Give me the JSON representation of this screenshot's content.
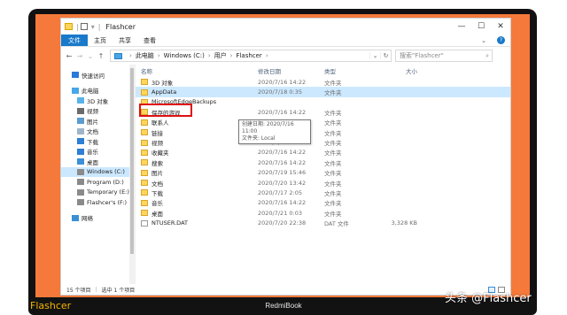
{
  "window": {
    "title": "Flashcer",
    "controls": {
      "minimize": "—",
      "maximize": "☐",
      "close": "✕"
    }
  },
  "ribbon": {
    "tabs": [
      "文件",
      "主页",
      "共享",
      "查看"
    ],
    "help_icon": "?"
  },
  "address": {
    "back_icon": "←",
    "forward_icon": "→",
    "up_icon": "↑",
    "crumbs": [
      "此电脑",
      "Windows (C:)",
      "用户",
      "Flashcer"
    ],
    "dropdown_icon": "⌄",
    "refresh_icon": "↻",
    "search_placeholder": "搜索\"Flashcer\"",
    "search_icon": "⌕"
  },
  "nav": {
    "items": [
      {
        "label": "快速访问",
        "level": 1,
        "icon": "star-icon",
        "color": "#2b79d8"
      },
      {
        "label": "此电脑",
        "level": 1,
        "icon": "pc-icon",
        "color": "#47a6e8",
        "gap": true
      },
      {
        "label": "3D 对象",
        "level": 2,
        "icon": "3d-objects-icon",
        "color": "#58b3e8"
      },
      {
        "label": "视频",
        "level": 2,
        "icon": "videos-icon",
        "color": "#6b6b6b"
      },
      {
        "label": "图片",
        "level": 2,
        "icon": "pictures-icon",
        "color": "#5c9ccf"
      },
      {
        "label": "文档",
        "level": 2,
        "icon": "documents-icon",
        "color": "#9fb5c9"
      },
      {
        "label": "下载",
        "level": 2,
        "icon": "downloads-icon",
        "color": "#2d7ed4"
      },
      {
        "label": "音乐",
        "level": 2,
        "icon": "music-icon",
        "color": "#2d7ed4"
      },
      {
        "label": "桌面",
        "level": 2,
        "icon": "desktop-icon",
        "color": "#3b8fd6"
      },
      {
        "label": "Windows (C:)",
        "level": 2,
        "icon": "drive-icon",
        "color": "#8a8a8a",
        "selected": true
      },
      {
        "label": "Program (D:)",
        "level": 2,
        "icon": "drive-icon",
        "color": "#8a8a8a"
      },
      {
        "label": "Temporary (E:)",
        "level": 2,
        "icon": "drive-icon",
        "color": "#8a8a8a"
      },
      {
        "label": "Flashcer's (F:)",
        "level": 2,
        "icon": "drive-icon",
        "color": "#8a8a8a"
      },
      {
        "label": "网络",
        "level": 1,
        "icon": "network-icon",
        "color": "#3b8fd6",
        "gap": true
      }
    ]
  },
  "columns": {
    "name": "名称",
    "date": "修改日期",
    "type": "类型",
    "size": "大小",
    "sort_icon": "^"
  },
  "files": [
    {
      "name": "3D 对象",
      "date": "2020/7/16 14:22",
      "type": "文件夹",
      "size": "",
      "kind": "folder",
      "icon": "3d-objects-icon"
    },
    {
      "name": "AppData",
      "date": "2020/7/18 0:35",
      "type": "文件夹",
      "size": "",
      "kind": "folder",
      "icon": "folder-icon",
      "selected": true
    },
    {
      "name": "MicrosoftEdgeBackups",
      "date": "",
      "type": "",
      "size": "",
      "kind": "folder",
      "icon": "folder-icon"
    },
    {
      "name": "保存的游戏",
      "date": "2020/7/16 14:22",
      "type": "文件夹",
      "size": "",
      "kind": "folder",
      "icon": "saved-games-icon"
    },
    {
      "name": "联系人",
      "date": "2020/7/16 14:22",
      "type": "文件夹",
      "size": "",
      "kind": "folder",
      "icon": "contacts-icon"
    },
    {
      "name": "链接",
      "date": "2020/7/16 14:22",
      "type": "文件夹",
      "size": "",
      "kind": "folder",
      "icon": "links-icon"
    },
    {
      "name": "视频",
      "date": "2020/7/20 23:09",
      "type": "文件夹",
      "size": "",
      "kind": "folder",
      "icon": "videos-icon"
    },
    {
      "name": "收藏夹",
      "date": "2020/7/16 14:22",
      "type": "文件夹",
      "size": "",
      "kind": "folder",
      "icon": "favorites-icon"
    },
    {
      "name": "搜索",
      "date": "2020/7/16 14:22",
      "type": "文件夹",
      "size": "",
      "kind": "folder",
      "icon": "search-folder-icon"
    },
    {
      "name": "图片",
      "date": "2020/7/19 15:46",
      "type": "文件夹",
      "size": "",
      "kind": "folder",
      "icon": "pictures-icon"
    },
    {
      "name": "文档",
      "date": "2020/7/20 13:42",
      "type": "文件夹",
      "size": "",
      "kind": "folder",
      "icon": "documents-icon"
    },
    {
      "name": "下载",
      "date": "2020/7/17 2:05",
      "type": "文件夹",
      "size": "",
      "kind": "folder",
      "icon": "downloads-icon"
    },
    {
      "name": "音乐",
      "date": "2020/7/16 14:22",
      "type": "文件夹",
      "size": "",
      "kind": "folder",
      "icon": "music-icon"
    },
    {
      "name": "桌面",
      "date": "2020/7/21 0:03",
      "type": "文件夹",
      "size": "",
      "kind": "folder",
      "icon": "desktop-icon"
    },
    {
      "name": "NTUSER.DAT",
      "date": "2020/7/20 22:38",
      "type": "DAT 文件",
      "size": "3,328 KB",
      "kind": "file",
      "icon": "dat-file-icon"
    }
  ],
  "tooltip": {
    "line1": "创建日期: 2020/7/16 11:00",
    "line2": "文件夹: Local"
  },
  "status": {
    "count": "15 个项目",
    "selected": "选中 1 个项目"
  },
  "branding": {
    "left": "Flashcer",
    "center": "RedmiBook",
    "watermark": "头条 @Flashcer"
  },
  "colors": {
    "accent": "#1979ca",
    "selection": "#cce8ff",
    "frame": "#f5793a",
    "highlight": "#e01010"
  }
}
